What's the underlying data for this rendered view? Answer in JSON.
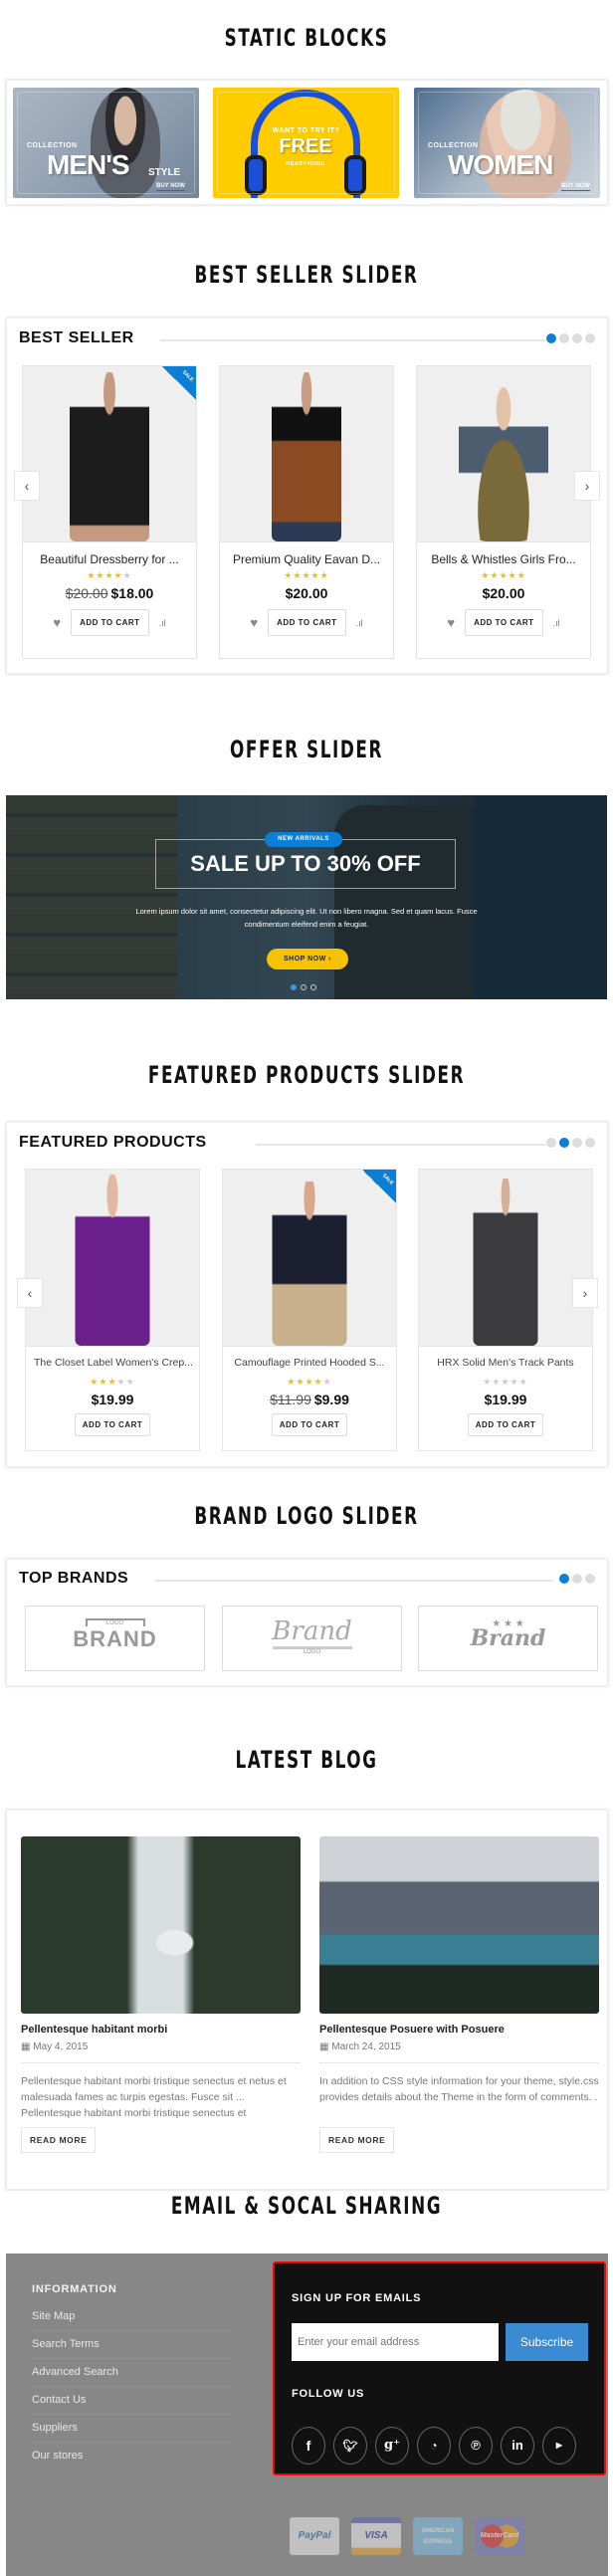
{
  "sections": {
    "static_blocks": "STATIC BLOCKS",
    "best_seller_slider": "BEST SELLER SLIDER",
    "offer_slider": "OFFER SLIDER",
    "featured_slider": "FEATURED PRODUCTS SLIDER",
    "brand_slider": "BRAND LOGO SLIDER",
    "latest_blog": "LATEST BLOG",
    "email_social": "EMAIL & SOCAL SHARING"
  },
  "static_blocks": [
    {
      "label_top": "COLLECTION",
      "label_big": "MEN'S",
      "label_small": "STYLE",
      "link": "BUY NOW"
    },
    {
      "label_top": "WANT TO TRY IT?",
      "label_big": "FREE",
      "label_small": "HEADPHONE"
    },
    {
      "label_top": "COLLECTION",
      "label_big": "WOMEN",
      "link": "BUY NOW"
    }
  ],
  "best_seller": {
    "heading": "BEST SELLER",
    "pager": {
      "count": 4,
      "active": 1
    },
    "products": [
      {
        "name": "Beautiful Dressberry for ...",
        "rating": 4,
        "old_price": "$20.00",
        "price": "$18.00",
        "badge": "SALE",
        "add_to_cart": "ADD TO CART"
      },
      {
        "name": "Premium Quality Eavan D...",
        "rating": 4.5,
        "price": "$20.00",
        "add_to_cart": "ADD TO CART"
      },
      {
        "name": "Bells & Whistles Girls Fro...",
        "rating": 5,
        "price": "$20.00",
        "add_to_cart": "ADD TO CART"
      }
    ]
  },
  "offer": {
    "badge": "NEW ARRIVALS",
    "headline": "SALE UP TO 30% OFF",
    "description": "Lorem ipsum dolor sit amet, consectetur adipiscing elit. Ut non libero magna. Sed et quam lacus. Fusce condimentum eleifend enim a feugiat.",
    "button": "SHOP NOW",
    "pager": {
      "count": 3,
      "active": 1
    }
  },
  "featured": {
    "heading": "FEATURED PRODUCTS",
    "pager": {
      "count": 4,
      "active": 2
    },
    "products": [
      {
        "name": "The Closet Label Women's Crep...",
        "rating": 3,
        "price": "$19.99",
        "add_to_cart": "ADD TO CART"
      },
      {
        "name": "Camouflage Printed Hooded S...",
        "rating": 4,
        "old_price": "$11.99",
        "price": "$9.99",
        "badge": "SALE",
        "add_to_cart": "ADD TO CART"
      },
      {
        "name": "HRX Solid Men's Track Pants",
        "rating": 0,
        "price": "$19.99",
        "add_to_cart": "ADD TO CART"
      }
    ]
  },
  "brands": {
    "heading": "TOP BRANDS",
    "pager": {
      "count": 3,
      "active": 1
    },
    "logos": [
      {
        "top": "LOGO",
        "main": "BRAND"
      },
      {
        "main": "Brand",
        "sub": "LOGO"
      },
      {
        "main": "Brand"
      }
    ]
  },
  "blog": {
    "posts": [
      {
        "title": "Pellentesque habitant morbi",
        "date": "May 4, 2015",
        "excerpt": "Pellentesque habitant morbi tristique senectus et netus et malesuada fames ac turpis egestas. Fusce sit ... Pellentesque habitant morbi tristique senectus et",
        "button": "READ MORE"
      },
      {
        "title": "Pellentesque Posuere with Posuere",
        "date": "March 24, 2015",
        "excerpt": "In addition to CSS style information for your theme, style.css provides details about the Theme in the form of comments. .",
        "button": "READ MORE"
      }
    ]
  },
  "footer": {
    "information": {
      "heading": "INFORMATION",
      "links": [
        "Site Map",
        "Search Terms",
        "Advanced Search",
        "Contact Us",
        "Suppliers",
        "Our stores"
      ]
    },
    "signup": {
      "heading": "SIGN UP FOR EMAILS",
      "placeholder": "Enter your email address",
      "button": "Subscribe"
    },
    "follow": {
      "heading": "FOLLOW US",
      "networks": [
        {
          "name": "facebook",
          "glyph": "f"
        },
        {
          "name": "twitter",
          "glyph": "t"
        },
        {
          "name": "google-plus",
          "glyph": "g+"
        },
        {
          "name": "rss",
          "glyph": "rss"
        },
        {
          "name": "pinterest",
          "glyph": "p"
        },
        {
          "name": "linkedin",
          "glyph": "in"
        },
        {
          "name": "youtube",
          "glyph": "yt"
        }
      ]
    },
    "payments": [
      "PayPal",
      "VISA",
      "AMERICAN EXPRESS",
      "MasterCard"
    ]
  },
  "colors": {
    "accent": "#0c7fd4",
    "star": "#f5c000",
    "shop_button": "#f7c200",
    "subscribe": "#3b8bd2",
    "highlight_border": "#ff0000",
    "footer_bg": "#878787"
  }
}
